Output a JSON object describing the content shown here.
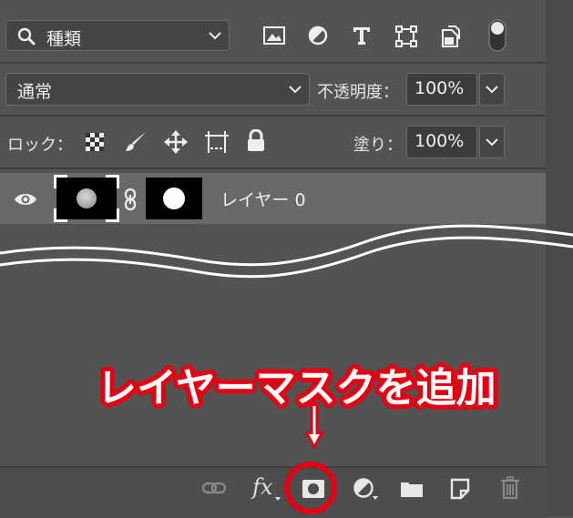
{
  "filter_bar": {
    "kind_label": "種類",
    "icons": [
      "image-filter-icon",
      "adjustment-filter-icon",
      "type-filter-icon",
      "shape-filter-icon",
      "smart-object-filter-icon",
      "filter-toggle"
    ]
  },
  "blend_bar": {
    "blend_mode": "通常",
    "opacity_label": "不透明度：",
    "opacity_value": "100%"
  },
  "lock_bar": {
    "lock_label": "ロック：",
    "fill_label": "塗り：",
    "fill_value": "100%"
  },
  "layers": [
    {
      "name": "レイヤー 0",
      "visible": true,
      "has_mask": true
    }
  ],
  "annotation": {
    "text": "レイヤーマスクを追加",
    "color": "#e60012"
  },
  "bottom_toolbar": {
    "fx_label": "fx",
    "icons": [
      "link-layers-icon",
      "fx-icon",
      "add-layer-mask-icon",
      "adjustment-layer-icon",
      "folder-icon",
      "new-layer-icon",
      "trash-icon"
    ]
  },
  "colors": {
    "panel_bg": "#535353",
    "selected_layer_bg": "#696969",
    "highlight": "#e60012"
  }
}
